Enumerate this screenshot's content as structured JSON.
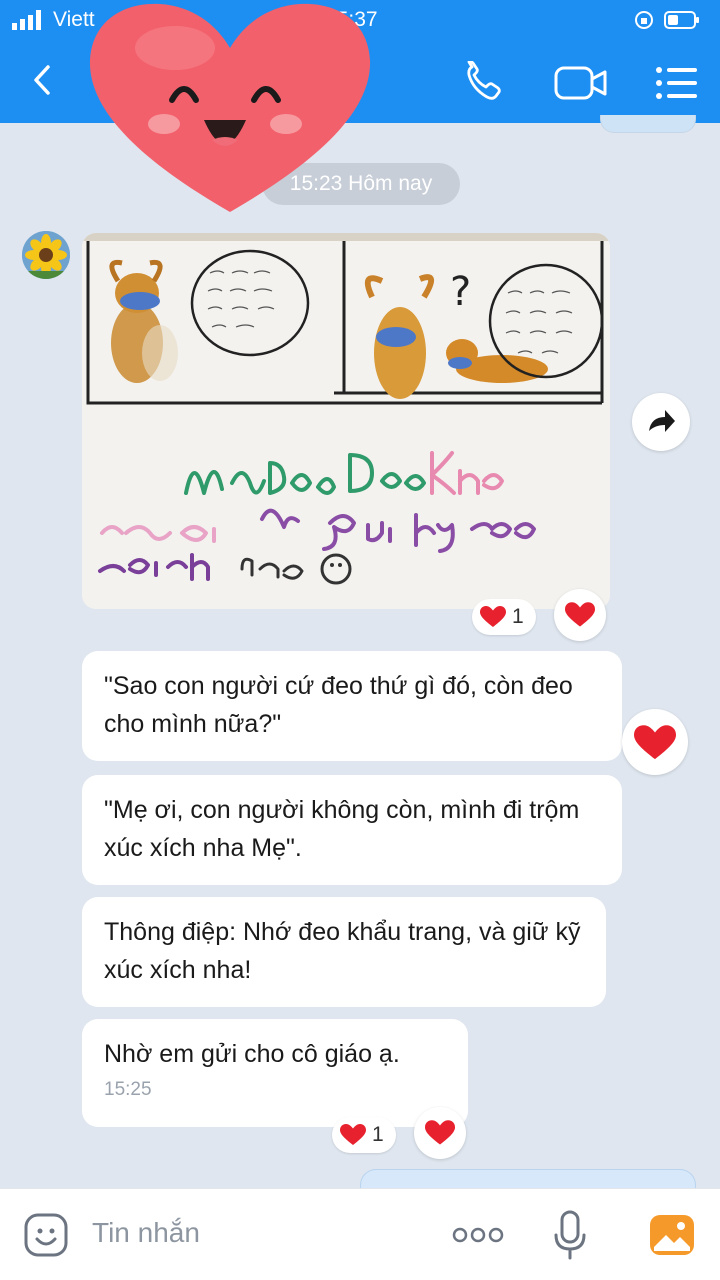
{
  "status_bar": {
    "carrier": "Viett",
    "time": "15:37"
  },
  "header": {
    "contact_name": "..."
  },
  "chat": {
    "date_separator": "15:23 Hôm nay",
    "photo": {
      "drawing_text": "Nhớ Đeo Khẩu Trang, và giữ kỹ xúc xích nha",
      "reaction_count": "1"
    },
    "messages": [
      {
        "text": "\"Sao con người cứ đeo thứ gì đó, còn đeo cho mình nữa?\""
      },
      {
        "text": "\"Mẹ ơi, con người không còn, mình đi trộm xúc xích nha Mẹ\"."
      },
      {
        "text": "Thông điệp: Nhớ đeo khẩu trang, và giữ kỹ xúc xích nha!"
      },
      {
        "text": "Nhờ em gửi cho cô giáo ạ.",
        "time": "15:25",
        "reaction_count": "1"
      }
    ]
  },
  "input_bar": {
    "placeholder": "Tin nhắn"
  },
  "colors": {
    "header_bg": "#1d8ff2",
    "chat_bg": "#dfe6ef",
    "heart_red": "#e8212e"
  },
  "icons": [
    "signal-icon",
    "lock-rotation-icon",
    "battery-icon",
    "back-icon",
    "phone-icon",
    "video-icon",
    "menu-icon",
    "heart-sticker",
    "forward-icon",
    "heart-icon",
    "sticker-icon",
    "more-icon",
    "mic-icon",
    "image-icon"
  ]
}
